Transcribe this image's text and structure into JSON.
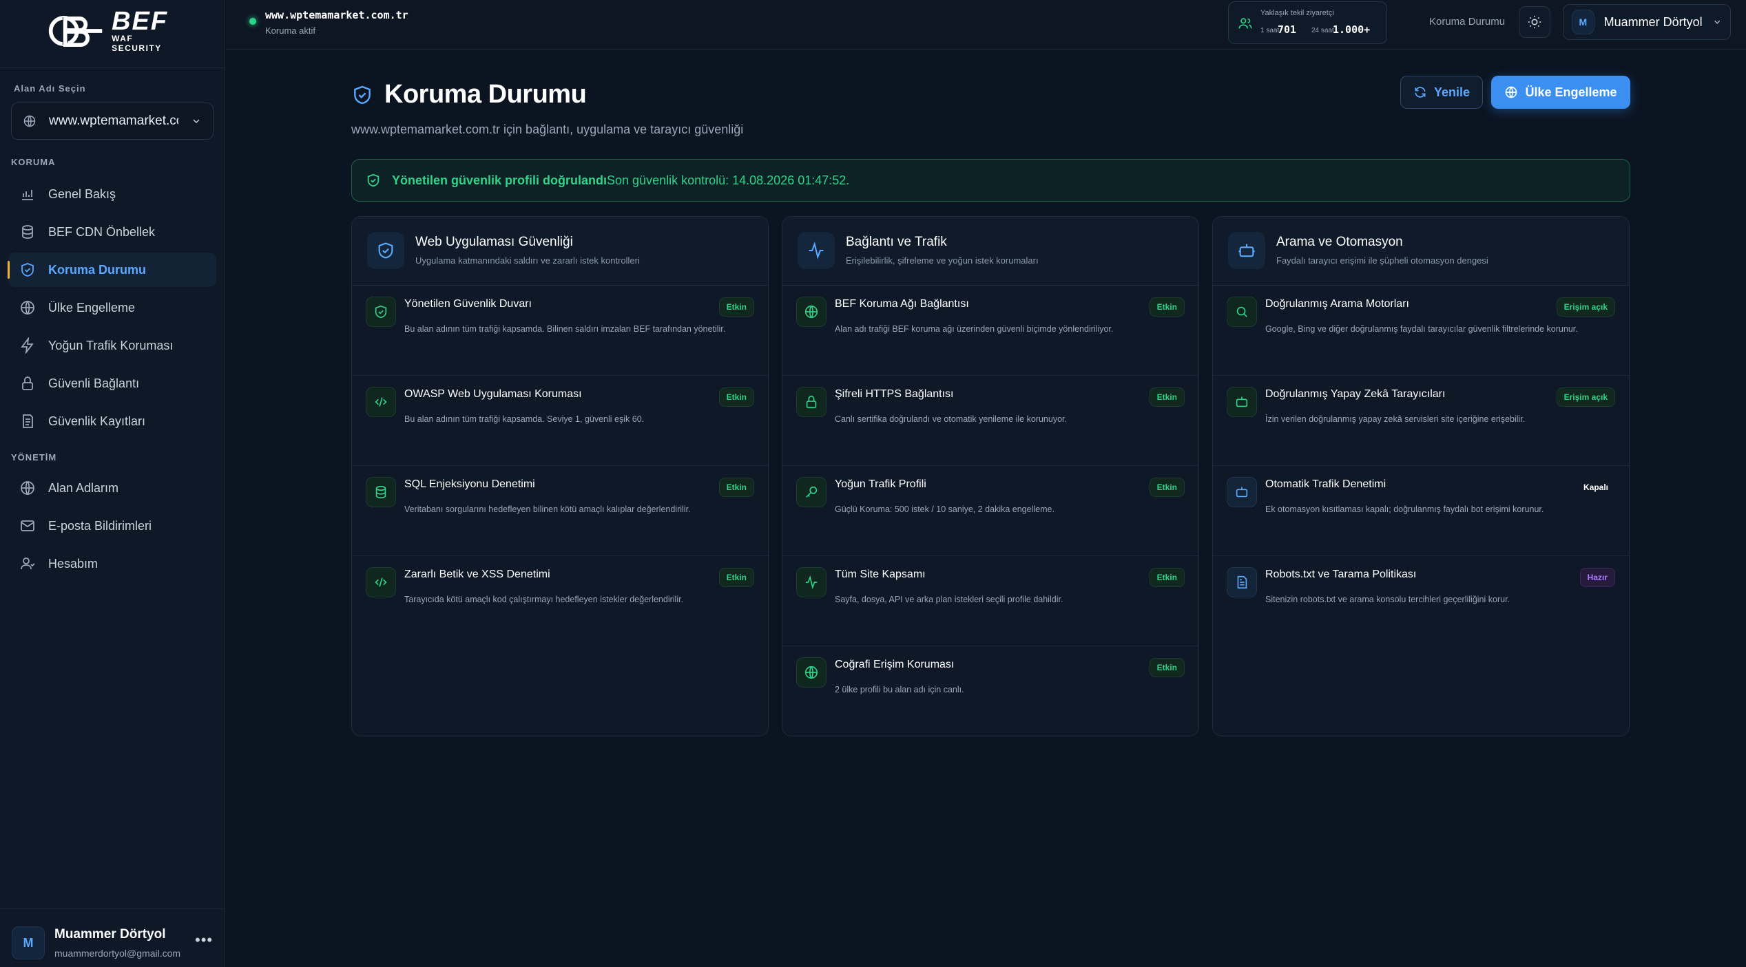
{
  "brand": {
    "name": "BEF",
    "sub": "WAF SECURITY"
  },
  "sidebar": {
    "domain_label": "Alan Adı Seçin",
    "domain_value": "www.wptemamarket.com.tr",
    "section_protection": "KORUMA",
    "section_admin": "YÖNETİM",
    "items": [
      {
        "label": "Genel Bakış",
        "icon": "chart-icon"
      },
      {
        "label": "BEF CDN Önbellek",
        "icon": "database-icon"
      },
      {
        "label": "Koruma Durumu",
        "icon": "shield-icon",
        "active": true
      },
      {
        "label": "Ülke Engelleme",
        "icon": "globe-icon"
      },
      {
        "label": "Yoğun Trafik Koruması",
        "icon": "bolt-icon"
      },
      {
        "label": "Güvenli Bağlantı",
        "icon": "lock-icon"
      },
      {
        "label": "Güvenlik Kayıtları",
        "icon": "log-icon"
      }
    ],
    "admin_items": [
      {
        "label": "Alan Adlarım",
        "icon": "globe-icon"
      },
      {
        "label": "E-posta Bildirimleri",
        "icon": "mail-icon"
      },
      {
        "label": "Hesabım",
        "icon": "user-icon"
      }
    ],
    "user": {
      "initial": "M",
      "name": "Muammer Dörtyol",
      "email": "muammerdortyol@gmail.com"
    }
  },
  "topbar": {
    "site_url": "www.wptemamarket.com.tr",
    "site_status": "Koruma aktif",
    "visitors_title": "Yaklaşık tekil ziyaretçi",
    "v1_label": "1 saat",
    "v1_value": "701",
    "v2_label": "24 saat",
    "v2_value": "1.000+",
    "page_name": "Koruma Durumu",
    "user_initial": "M",
    "user_name": "Muammer Dörtyol"
  },
  "main": {
    "title": "Koruma Durumu",
    "subtitle": "www.wptemamarket.com.tr için bağlantı, uygulama ve tarayıcı güvenliği",
    "refresh_label": "Yenile",
    "block_label": "Ülke Engelleme",
    "alert_strong": "Yönetilen güvenlik profili doğrulandı",
    "alert_rest": "Son güvenlik kontrolü: 14.08.2026 01:47:52."
  },
  "cards": [
    {
      "title": "Web Uygulaması Güvenliği",
      "subtitle": "Uygulama katmanındaki saldırı ve zararlı istek kontrolleri",
      "rows": [
        {
          "title": "Yönetilen Güvenlik Duvarı",
          "desc": "Bu alan adının tüm trafiği kapsamda. Bilinen saldırı imzaları BEF tarafından yönetilir.",
          "badge": "Etkin"
        },
        {
          "title": "OWASP Web Uygulaması Koruması",
          "desc": "Bu alan adının tüm trafiği kapsamda. Seviye 1, güvenli eşik 60.",
          "badge": "Etkin"
        },
        {
          "title": "SQL Enjeksiyonu Denetimi",
          "desc": "Veritabanı sorgularını hedefleyen bilinen kötü amaçlı kalıplar değerlendirilir.",
          "badge": "Etkin"
        },
        {
          "title": "Zararlı Betik ve XSS Denetimi",
          "desc": "Tarayıcıda kötü amaçlı kod çalıştırmayı hedefleyen istekler değerlendirilir.",
          "badge": "Etkin"
        }
      ]
    },
    {
      "title": "Bağlantı ve Trafik",
      "subtitle": "Erişilebilirlik, şifreleme ve yoğun istek korumaları",
      "rows": [
        {
          "title": "BEF Koruma Ağı Bağlantısı",
          "desc": "Alan adı trafiği BEF koruma ağı üzerinden güvenli biçimde yönlendiriliyor.",
          "badge": "Etkin"
        },
        {
          "title": "Şifreli HTTPS Bağlantısı",
          "desc": "Canlı sertifika doğrulandı ve otomatik yenileme ile korunuyor.",
          "badge": "Etkin"
        },
        {
          "title": "Yoğun Trafik Profili",
          "desc": "Güçlü Koruma: 500 istek / 10 saniye, 2 dakika engelleme.",
          "badge": "Etkin"
        },
        {
          "title": "Tüm Site Kapsamı",
          "desc": "Sayfa, dosya, API ve arka plan istekleri seçili profile dahildir.",
          "badge": "Etkin"
        },
        {
          "title": "Coğrafi Erişim Koruması",
          "desc": "2 ülke profili bu alan adı için canlı.",
          "badge": "Etkin"
        }
      ]
    },
    {
      "title": "Arama ve Otomasyon",
      "subtitle": "Faydalı tarayıcı erişimi ile şüpheli otomasyon dengesi",
      "rows": [
        {
          "title": "Doğrulanmış Arama Motorları",
          "desc": "Google, Bing ve diğer doğrulanmış faydalı tarayıcılar güvenlik filtrelerinde korunur.",
          "badge": "Erişim açık"
        },
        {
          "title": "Doğrulanmış Yapay Zekâ Tarayıcıları",
          "desc": "İzin verilen doğrulanmış yapay zekâ servisleri site içeriğine erişebilir.",
          "badge": "Erişim açık"
        },
        {
          "title": "Otomatik Trafik Denetimi",
          "desc": "Ek otomasyon kısıtlaması kapalı; doğrulanmış faydalı bot erişimi korunur.",
          "badge": "Kapalı"
        },
        {
          "title": "Robots.txt ve Tarama Politikası",
          "desc": "Sitenizin robots.txt ve arama konsolu tercihleri geçerliliğini korur.",
          "badge": "Hazır"
        }
      ]
    }
  ]
}
